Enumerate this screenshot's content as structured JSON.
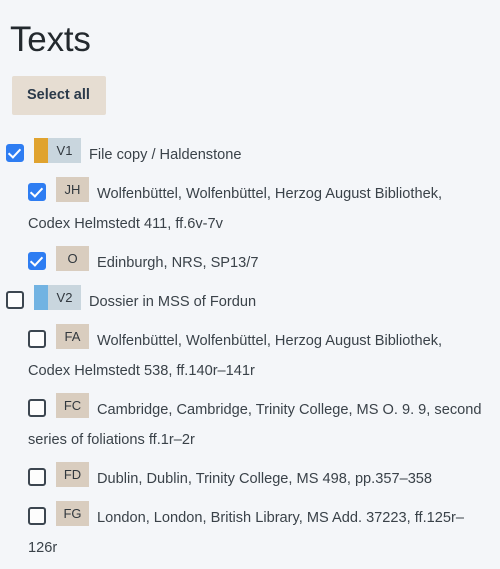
{
  "page": {
    "title": "Texts"
  },
  "toolbar": {
    "select_all_label": "Select all"
  },
  "colors": {
    "background": "#f4f6f9",
    "button_bg": "#e6ddd2",
    "button_text": "#2b3a4a",
    "checkbox_checked": "#2e7df2",
    "checkbox_border": "#3c4650",
    "badge_tan": "#d9cdbf",
    "badge_grey": "#c9d6de",
    "stripe_orange": "#e0a32f",
    "stripe_blue": "#72b3e2",
    "text": "#3a4249"
  },
  "list": {
    "items": [
      {
        "level": "parent",
        "checked": true,
        "sigil": "V1",
        "badge_style": "grey",
        "stripe": "#e0a32f",
        "label": "File copy / Haldenstone"
      },
      {
        "level": "child",
        "checked": true,
        "sigil": "JH",
        "badge_style": "tan",
        "stripe": null,
        "label": "Wolfenbüttel, Wolfenbüttel, Herzog August Bibliothek, Codex Helmstedt 411, ff.6v-7v"
      },
      {
        "level": "child",
        "checked": true,
        "sigil": "O",
        "badge_style": "tan",
        "stripe": null,
        "label": "Edinburgh, NRS, SP13/7"
      },
      {
        "level": "parent",
        "checked": false,
        "sigil": "V2",
        "badge_style": "grey",
        "stripe": "#72b3e2",
        "label": "Dossier in MSS of Fordun"
      },
      {
        "level": "child",
        "checked": false,
        "sigil": "FA",
        "badge_style": "tan",
        "stripe": null,
        "label": "Wolfenbüttel, Wolfenbüttel, Herzog August Bibliothek, Codex Helmstedt 538, ff.140r–141r"
      },
      {
        "level": "child",
        "checked": false,
        "sigil": "FC",
        "badge_style": "tan",
        "stripe": null,
        "label": "Cambridge, Cambridge, Trinity College, MS O. 9. 9, second series of foliations ff.1r–2r"
      },
      {
        "level": "child",
        "checked": false,
        "sigil": "FD",
        "badge_style": "tan",
        "stripe": null,
        "label": "Dublin, Dublin, Trinity College, MS 498, pp.357–358"
      },
      {
        "level": "child",
        "checked": false,
        "sigil": "FG",
        "badge_style": "tan",
        "stripe": null,
        "label": "London, London, British Library, MS Add. 37223, ff.125r–126r"
      }
    ]
  }
}
